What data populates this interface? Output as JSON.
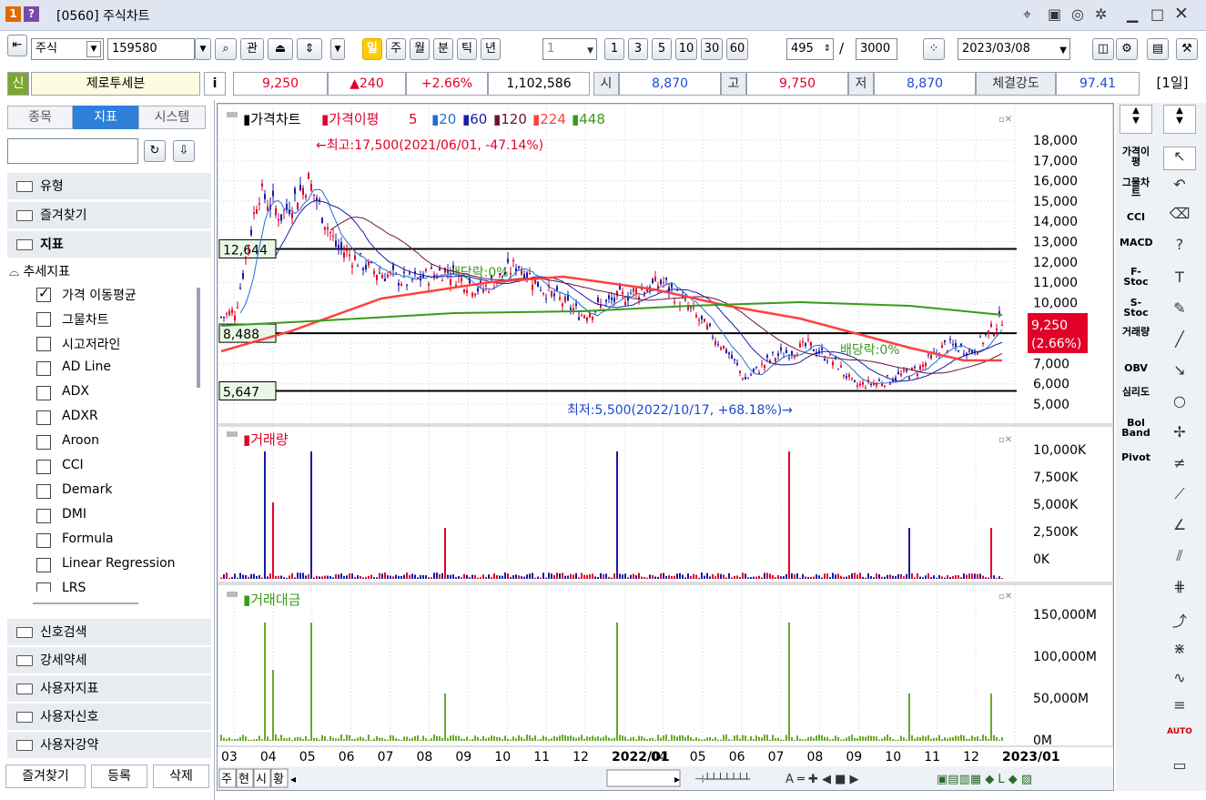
{
  "window": {
    "number": "1",
    "help": "?",
    "title": "[0560] 주식차트",
    "icons": [
      "pin-icon",
      "layout-icon",
      "camera-icon",
      "gear-icon",
      "minimize-icon",
      "maximize-icon",
      "close-icon"
    ]
  },
  "toolbar": {
    "market": "주식",
    "code": "159580",
    "search_icon": "search-icon",
    "gwan": "관",
    "periods": [
      "일",
      "주",
      "월",
      "분",
      "틱",
      "년"
    ],
    "active_period": "일",
    "interval": "1",
    "quick_intervals": [
      "1",
      "3",
      "5",
      "10",
      "30",
      "60"
    ],
    "count": "495",
    "total": "/",
    "total_value": "3000",
    "date": "2023/03/08"
  },
  "quote": {
    "sin": "신",
    "name": "제로투세븐",
    "info": "i",
    "price": "9,250",
    "change": "▲240",
    "rate": "+2.66%",
    "volume": "1,102,586",
    "open_label": "시",
    "open": "8,870",
    "high_label": "고",
    "high": "9,750",
    "low_label": "저",
    "low": "8,870",
    "strength_label": "체결강도",
    "strength": "97.41",
    "period_label": "[1일]"
  },
  "sidebar": {
    "tabs": [
      "종목",
      "지표",
      "시스템"
    ],
    "active_tab": "지표",
    "categories": [
      "유형",
      "즐겨찾기",
      "지표"
    ],
    "group": "추세지표",
    "items": [
      {
        "label": "가격 이동평균",
        "checked": true
      },
      {
        "label": "그물차트",
        "checked": false
      },
      {
        "label": "시고저라인",
        "checked": false
      },
      {
        "label": "AD Line",
        "checked": false
      },
      {
        "label": "ADX",
        "checked": false
      },
      {
        "label": "ADXR",
        "checked": false
      },
      {
        "label": "Aroon",
        "checked": false
      },
      {
        "label": "CCI",
        "checked": false
      },
      {
        "label": "Demark",
        "checked": false
      },
      {
        "label": "DMI",
        "checked": false
      },
      {
        "label": "Formula",
        "checked": false
      },
      {
        "label": "Linear Regression",
        "checked": false
      },
      {
        "label": "LRS",
        "checked": false
      }
    ],
    "bottom_categories": [
      "신호검색",
      "강세약세",
      "사용자지표",
      "사용자신호",
      "사용자강약"
    ],
    "bottom_buttons": [
      "즐겨찾기",
      "등록",
      "삭제"
    ]
  },
  "chart": {
    "price_legend": {
      "main": "가격차트",
      "ma": "가격이평",
      "periods": [
        "5",
        "20",
        "60",
        "120",
        "224",
        "448"
      ],
      "colors": [
        "#e0002a",
        "#1f6fd6",
        "#1a1aa6",
        "#6b1436",
        "#ff4040",
        "#3a9a1a"
      ]
    },
    "hi_note": "←최고:17,500(2021/06/01, -47.14%)",
    "lo_note": "최저:5,500(2022/10/17, +68.18%)→",
    "div_note": "배당락:0%",
    "levels": [
      "12,644",
      "8,488",
      "5,647"
    ],
    "price_axis": [
      "18,000",
      "17,000",
      "16,000",
      "15,000",
      "14,000",
      "13,000",
      "12,000",
      "11,000",
      "10,000",
      "9,000",
      "8,000",
      "7,000",
      "6,000",
      "5,000"
    ],
    "current": "9,250",
    "current_rate": "(2.66%)",
    "vol_title": "거래량",
    "vol_axis": [
      "10,000K",
      "7,500K",
      "5,000K",
      "2,500K",
      "0K"
    ],
    "amt_title": "거래대금",
    "amt_axis": [
      "150,000M",
      "100,000M",
      "50,000M",
      "0M"
    ],
    "x_labels": [
      "03",
      "04",
      "05",
      "06",
      "07",
      "08",
      "09",
      "10",
      "11",
      "12",
      "2022/01",
      "04",
      "05",
      "06",
      "07",
      "08",
      "09",
      "10",
      "11",
      "12",
      "2023/01"
    ],
    "bottom_tabs": [
      "주",
      "현",
      "시",
      "황"
    ]
  },
  "right_indicators": [
    "가격이평",
    "그물차트",
    "CCI",
    "MACD",
    "F-Stoc",
    "S-Stoc",
    "거래량",
    "OBV",
    "심리도",
    "Bol Band",
    "Pivot"
  ],
  "chart_data": {
    "type": "line",
    "title": "가격차트",
    "series": [
      {
        "name": "가격이평 5"
      },
      {
        "name": "20"
      },
      {
        "name": "60"
      },
      {
        "name": "120"
      },
      {
        "name": "224"
      },
      {
        "name": "448"
      }
    ],
    "ylim": [
      5000,
      18000
    ],
    "x": [
      "03",
      "04",
      "05",
      "06",
      "07",
      "08",
      "09",
      "10",
      "11",
      "12",
      "2022/01",
      "04",
      "05",
      "06",
      "07",
      "08",
      "09",
      "10",
      "11",
      "12",
      "2023/01"
    ],
    "high": 17500,
    "low": 5500,
    "last": 9250
  }
}
